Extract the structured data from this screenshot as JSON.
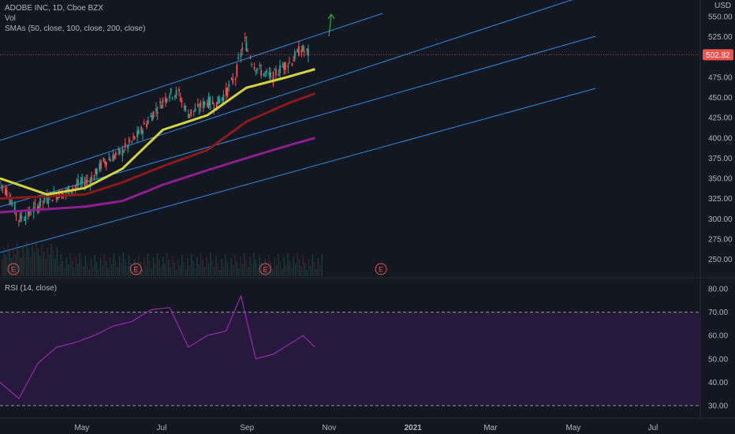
{
  "symbol_title": "ADOBE INC, 1D, Cboe BZX",
  "volume_label": "Vol",
  "sma_label": "SMAs (50, close, 100, close, 200, close)",
  "rsi_label": "RSI (14, close)",
  "currency": "USD",
  "last_price": "502.82",
  "earnings_marker": "E",
  "colors": {
    "background": "#131722",
    "up": "#26a69a",
    "down": "#ef5350",
    "sma50": "#d4d43a",
    "sma100": "#8b1a1a",
    "sma200": "#8e1d8e",
    "channel": "#2d8ae0",
    "rsi": "#9c27b0",
    "rsi_band": "#2a1a3e",
    "price_badge": "#ef5350",
    "arrow": "#33cc33"
  },
  "chart_data": {
    "type": "candlestick",
    "x_labels": [
      "May",
      "Jul",
      "Sep",
      "Nov",
      "2021",
      "Mar",
      "May",
      "Jul"
    ],
    "price_ticks": [
      "550.00",
      "525.00",
      "500.00",
      "475.00",
      "450.00",
      "425.00",
      "400.00",
      "375.00",
      "350.00",
      "325.00",
      "300.00",
      "275.00",
      "250.00"
    ],
    "rsi_ticks": [
      "80.00",
      "70.00",
      "60.00",
      "50.00",
      "40.00",
      "30.00"
    ],
    "rsi_bands": [
      70,
      30
    ],
    "earnings_dates": [
      "2020-03-12",
      "2020-06-11",
      "2020-09-15",
      "2020-12-10"
    ],
    "price_close_path": [
      [
        "2020-03-02",
        345
      ],
      [
        "2020-03-09",
        330
      ],
      [
        "2020-03-16",
        300
      ],
      [
        "2020-03-23",
        305
      ],
      [
        "2020-03-30",
        315
      ],
      [
        "2020-04-06",
        325
      ],
      [
        "2020-04-13",
        330
      ],
      [
        "2020-04-20",
        332
      ],
      [
        "2020-04-27",
        340
      ],
      [
        "2020-05-04",
        345
      ],
      [
        "2020-05-11",
        352
      ],
      [
        "2020-05-18",
        370
      ],
      [
        "2020-05-25",
        376
      ],
      [
        "2020-06-01",
        383
      ],
      [
        "2020-06-08",
        395
      ],
      [
        "2020-06-15",
        408
      ],
      [
        "2020-06-22",
        425
      ],
      [
        "2020-06-29",
        440
      ],
      [
        "2020-07-06",
        455
      ],
      [
        "2020-07-13",
        455
      ],
      [
        "2020-07-20",
        430
      ],
      [
        "2020-07-27",
        435
      ],
      [
        "2020-08-03",
        445
      ],
      [
        "2020-08-10",
        442
      ],
      [
        "2020-08-17",
        455
      ],
      [
        "2020-08-24",
        475
      ],
      [
        "2020-08-31",
        520
      ],
      [
        "2020-09-07",
        490
      ],
      [
        "2020-09-14",
        480
      ],
      [
        "2020-09-21",
        475
      ],
      [
        "2020-09-28",
        488
      ],
      [
        "2020-10-05",
        495
      ],
      [
        "2020-10-12",
        510
      ],
      [
        "2020-10-19",
        502.82
      ]
    ],
    "sma50": [
      [
        "2020-03-02",
        350
      ],
      [
        "2020-04-06",
        330
      ],
      [
        "2020-05-04",
        338
      ],
      [
        "2020-06-01",
        362
      ],
      [
        "2020-07-01",
        410
      ],
      [
        "2020-08-03",
        428
      ],
      [
        "2020-09-01",
        462
      ],
      [
        "2020-10-01",
        475
      ],
      [
        "2020-10-22",
        485
      ]
    ],
    "sma100": [
      [
        "2020-03-02",
        325
      ],
      [
        "2020-05-04",
        330
      ],
      [
        "2020-06-01",
        345
      ],
      [
        "2020-07-01",
        365
      ],
      [
        "2020-08-03",
        385
      ],
      [
        "2020-09-01",
        420
      ],
      [
        "2020-10-01",
        442
      ],
      [
        "2020-10-22",
        455
      ]
    ],
    "sma200": [
      [
        "2020-03-02",
        308
      ],
      [
        "2020-05-04",
        315
      ],
      [
        "2020-06-01",
        322
      ],
      [
        "2020-07-01",
        342
      ],
      [
        "2020-08-03",
        360
      ],
      [
        "2020-09-01",
        375
      ],
      [
        "2020-10-01",
        390
      ],
      [
        "2020-10-22",
        400
      ]
    ],
    "rsi": [
      [
        "2020-03-02",
        40
      ],
      [
        "2020-03-16",
        33
      ],
      [
        "2020-03-30",
        48
      ],
      [
        "2020-04-13",
        55
      ],
      [
        "2020-04-27",
        57
      ],
      [
        "2020-05-11",
        60
      ],
      [
        "2020-05-25",
        64
      ],
      [
        "2020-06-08",
        66
      ],
      [
        "2020-06-22",
        71
      ],
      [
        "2020-07-06",
        72
      ],
      [
        "2020-07-20",
        55
      ],
      [
        "2020-08-03",
        60
      ],
      [
        "2020-08-17",
        62
      ],
      [
        "2020-08-28",
        77
      ],
      [
        "2020-09-08",
        50
      ],
      [
        "2020-09-21",
        52
      ],
      [
        "2020-10-05",
        57
      ],
      [
        "2020-10-13",
        60
      ],
      [
        "2020-10-22",
        55
      ]
    ]
  }
}
